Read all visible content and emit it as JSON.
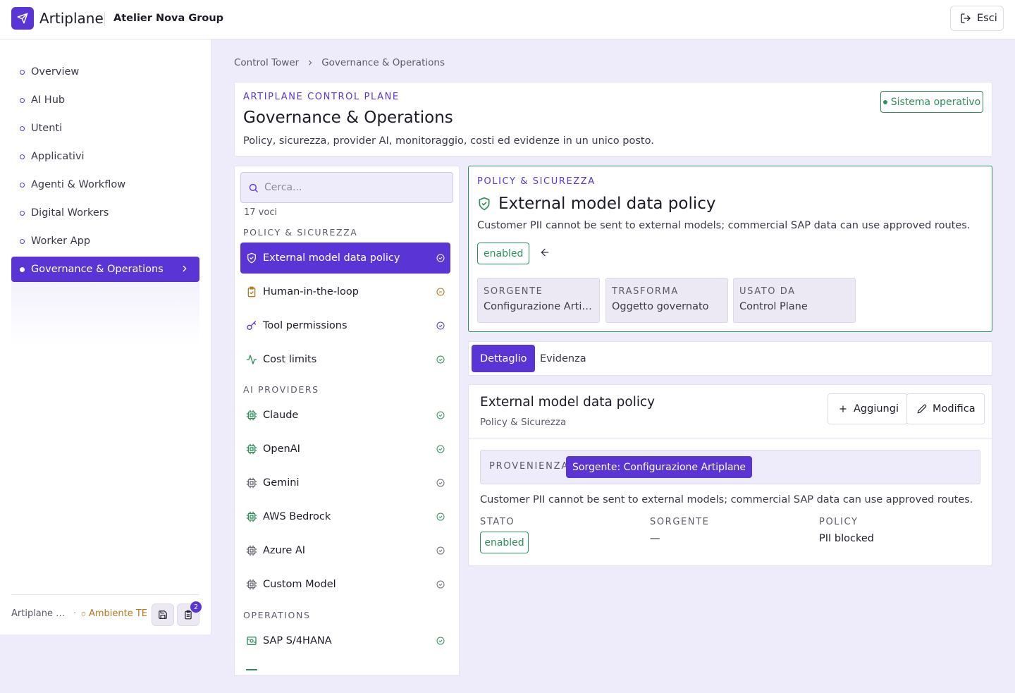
{
  "topbar": {
    "brand": "Artiplane",
    "org": "Atelier Nova Group",
    "logout_label": "Esci"
  },
  "sidebar": {
    "items": [
      {
        "label": "Overview"
      },
      {
        "label": "AI Hub"
      },
      {
        "label": "Utenti"
      },
      {
        "label": "Applicativi"
      },
      {
        "label": "Agenti & Workflow"
      },
      {
        "label": "Digital Workers"
      },
      {
        "label": "Worker App"
      },
      {
        "label": "Governance & Operations",
        "active": true
      }
    ],
    "footer": {
      "version": "Artiplane v…",
      "separator": "·",
      "env": "Ambiente TE",
      "badge_count": "2"
    }
  },
  "breadcrumb": {
    "root": "Control Tower",
    "current": "Governance & Operations"
  },
  "hero": {
    "eyebrow": "ARTIPLANE CONTROL PLANE",
    "title": "Governance & Operations",
    "subtitle": "Policy, sicurezza, provider AI, monitoraggio, costi ed evidenze in un unico posto.",
    "status": "Sistema operativo"
  },
  "list": {
    "search_placeholder": "Cerca...",
    "count": "17 voci",
    "groups": [
      {
        "label": "POLICY & SICUREZZA"
      },
      {
        "label": "AI PROVIDERS"
      },
      {
        "label": "OPERATIONS"
      }
    ],
    "items": [
      {
        "label": "External model data policy",
        "icon": "shield-check-icon"
      },
      {
        "label": "Human-in-the-loop",
        "icon": "clipboard-check-icon"
      },
      {
        "label": "Tool permissions",
        "icon": "key-icon"
      },
      {
        "label": "Cost limits",
        "icon": "activity-icon"
      },
      {
        "label": "Claude",
        "icon": "chip-icon"
      },
      {
        "label": "OpenAI",
        "icon": "chip-icon"
      },
      {
        "label": "Gemini",
        "icon": "chip-icon"
      },
      {
        "label": "AWS Bedrock",
        "icon": "chip-icon"
      },
      {
        "label": "Azure AI",
        "icon": "chip-icon"
      },
      {
        "label": "Custom Model",
        "icon": "chip-icon"
      },
      {
        "label": "SAP S/4HANA",
        "icon": "server-icon"
      }
    ]
  },
  "detail": {
    "eyebrow": "POLICY & SICUREZZA",
    "title": "External model data policy",
    "description": "Customer PII cannot be sent to external models; commercial SAP data can use approved routes.",
    "status": "enabled",
    "meta": [
      {
        "key": "SORGENTE",
        "value": "Configurazione Artiplane"
      },
      {
        "key": "TRASFORMA",
        "value": "Oggetto governato"
      },
      {
        "key": "USATO DA",
        "value": "Control Plane"
      }
    ]
  },
  "tabs": [
    {
      "label": "Dettaglio"
    },
    {
      "label": "Evidenza"
    }
  ],
  "record": {
    "title": "External model data policy",
    "subtitle": "Policy & Sicurezza",
    "add_label": "Aggiungi",
    "edit_label": "Modifica",
    "provenance_key": "PROVENIENZA",
    "provenance_value": "Sorgente: Configurazione Artiplane",
    "description": "Customer PII cannot be sent to external models; commercial SAP data can use approved routes.",
    "fields": [
      {
        "key": "STATO",
        "value": "enabled"
      },
      {
        "key": "SORGENTE",
        "value": "—"
      },
      {
        "key": "POLICY",
        "value": "PII blocked"
      }
    ]
  },
  "colors": {
    "accent": "#5b34d6",
    "success": "#2f8f5b",
    "warning": "#b7791f",
    "background": "#eeebfa"
  }
}
